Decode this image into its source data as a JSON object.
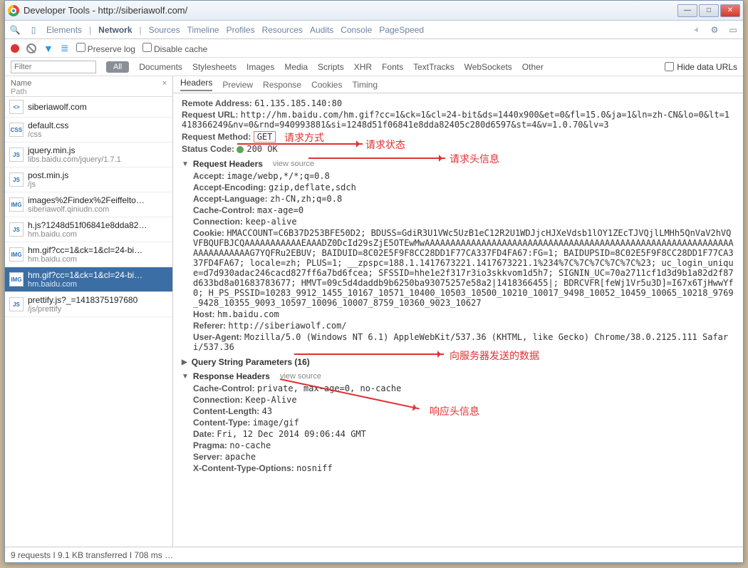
{
  "window": {
    "title": "Developer Tools - http://siberiawolf.com/"
  },
  "toptabs": [
    "Elements",
    "Network",
    "Sources",
    "Timeline",
    "Profiles",
    "Resources",
    "Audits",
    "Console",
    "PageSpeed"
  ],
  "toptabs_active": 1,
  "toolbar": {
    "preserve": "Preserve log",
    "disable": "Disable cache"
  },
  "filter": {
    "placeholder": "Filter",
    "all": "All",
    "hide": "Hide data URLs",
    "tabs": [
      "Documents",
      "Stylesheets",
      "Images",
      "Media",
      "Scripts",
      "XHR",
      "Fonts",
      "TextTracks",
      "WebSockets",
      "Other"
    ]
  },
  "sidebar": {
    "col1": "Name",
    "col2": "Path",
    "items": [
      {
        "icon": "<>",
        "name": "siberiawolf.com",
        "sub": ""
      },
      {
        "icon": "CSS",
        "name": "default.css",
        "sub": "/css"
      },
      {
        "icon": "JS",
        "name": "jquery.min.js",
        "sub": "libs.baidu.com/jquery/1.7.1"
      },
      {
        "icon": "JS",
        "name": "post.min.js",
        "sub": "/js"
      },
      {
        "icon": "IMG",
        "name": "images%2Findex%2Feiffelto…",
        "sub": "siberiawolf.qiniudn.com"
      },
      {
        "icon": "JS",
        "name": "h.js?1248d51f06841e8dda82…",
        "sub": "hm.baidu.com"
      },
      {
        "icon": "IMG",
        "name": "hm.gif?cc=1&ck=1&cl=24-bi…",
        "sub": "hm.baidu.com"
      },
      {
        "icon": "IMG",
        "name": "hm.gif?cc=1&ck=1&cl=24-bi…",
        "sub": "hm.baidu.com"
      },
      {
        "icon": "JS",
        "name": "prettify.js?_=1418375197680",
        "sub": "/js/prettify"
      }
    ],
    "selected": 7
  },
  "detailtabs": [
    "Headers",
    "Preview",
    "Response",
    "Cookies",
    "Timing"
  ],
  "general": {
    "remote_k": "Remote Address:",
    "remote_v": "61.135.185.140:80",
    "url_k": "Request URL:",
    "url_v": "http://hm.baidu.com/hm.gif?cc=1&ck=1&cl=24-bit&ds=1440x900&et=0&fl=15.0&ja=1&ln=zh-CN&lo=0&lt=1418366249&nv=0&rnd=940993881&si=1248d51f06841e8dda82405c280d6597&st=4&v=1.0.70&lv=3",
    "method_k": "Request Method:",
    "method_v": "GET",
    "status_k": "Status Code:",
    "status_v": "200 OK"
  },
  "reqhead_title": "Request Headers",
  "viewsource": "view source",
  "reqhead": [
    {
      "k": "Accept:",
      "v": "image/webp,*/*;q=0.8"
    },
    {
      "k": "Accept-Encoding:",
      "v": "gzip,deflate,sdch"
    },
    {
      "k": "Accept-Language:",
      "v": "zh-CN,zh;q=0.8"
    },
    {
      "k": "Cache-Control:",
      "v": "max-age=0"
    },
    {
      "k": "Connection:",
      "v": "keep-alive"
    },
    {
      "k": "Cookie:",
      "v": "HMACCOUNT=C6B37D253BFE50D2; BDUSS=GdiR3U1VWc5UzB1eC12R2U1WDJjcHJXeVdsb1lOY1ZEcTJVQjlLMHh5QnVaV2hVQVFBQUFBJCQAAAAAAAAAAAEAAADZ0DcId29sZjE5OTEwMwAAAAAAAAAAAAAAAAAAAAAAAAAAAAAAAAAAAAAAAAAAAAAAAAAAAAAAAAAAAAAAAAAAAAAAAG7YQFRu2EBUV; BAIDUID=8C02E5F9F8CC28DD1F77CA337FD4FA67:FG=1; BAIDUPSID=8C02E5F9F8CC28DD1F77CA337FD4FA67; locale=zh; PLUS=1; __zpspc=188.1.1417673221.1417673221.1%234%7C%7C%7C%7C%7C%23; uc_login_unique=d7d930adac246cacd827ff6a7bd6fcea; SFSSID=hhe1e2f317r3io3skkvom1d5h7; SIGNIN_UC=70a2711cf1d3d9b1a82d2f87d633bd8a01683783677; HMVT=09c5d4daddb9b6250ba93075257e58a2|1418366455|; BDRCVFR[feWj1Vr5u3D]=I67x6TjHwwYf0; H_PS_PSSID=10283_9912_1455_10167_10571_10400_10503_10500_10210_10017_9498_10052_10459_10065_10218_9769_9428_10355_9093_10597_10096_10007_8759_10360_9023_10627"
    },
    {
      "k": "Host:",
      "v": "hm.baidu.com"
    },
    {
      "k": "Referer:",
      "v": "http://siberiawolf.com/"
    },
    {
      "k": "User-Agent:",
      "v": "Mozilla/5.0 (Windows NT 6.1) AppleWebKit/537.36 (KHTML, like Gecko) Chrome/38.0.2125.111 Safari/537.36"
    }
  ],
  "query_title": "Query String Parameters (16)",
  "reshead_title": "Response Headers",
  "reshead": [
    {
      "k": "Cache-Control:",
      "v": "private, max-age=0, no-cache"
    },
    {
      "k": "Connection:",
      "v": "Keep-Alive"
    },
    {
      "k": "Content-Length:",
      "v": "43"
    },
    {
      "k": "Content-Type:",
      "v": "image/gif"
    },
    {
      "k": "Date:",
      "v": "Fri, 12 Dec 2014 09:06:44 GMT"
    },
    {
      "k": "Pragma:",
      "v": "no-cache"
    },
    {
      "k": "Server:",
      "v": "apache"
    },
    {
      "k": "X-Content-Type-Options:",
      "v": "nosniff"
    }
  ],
  "annots": {
    "a1": "请求方式",
    "a2": "请求状态",
    "a3": "请求头信息",
    "a4": "向服务器发送的数据",
    "a5": "响应头信息"
  },
  "status": "9 requests I 9.1 KB transferred I 708 ms …"
}
